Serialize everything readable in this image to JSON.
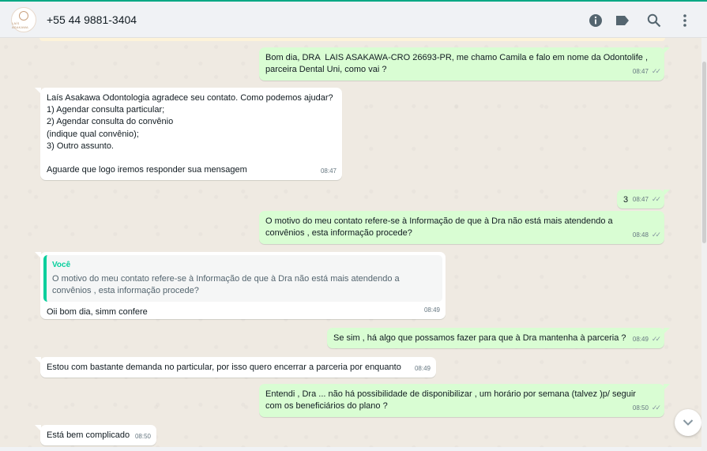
{
  "header": {
    "avatar_text": "LAÍS ASAKAWA",
    "contact_name": "+55 44 9881-3404",
    "icons": [
      "info-icon",
      "label-icon",
      "search-icon",
      "menu-icon"
    ]
  },
  "messages": [
    {
      "dir": "out",
      "text": "Bom dia, DRA  LAIS ASAKAWA-CRO 26693-PR, me chamo Camila e falo em nome da Odontolife ,\nparceira Dental Uni, como vai ?",
      "time": "08:47",
      "ticks": "✓✓"
    },
    {
      "dir": "in",
      "text": "Laís Asakawa Odontologia agradece seu contato. Como podemos ajudar?\n1) Agendar consulta particular;\n2) Agendar consulta do convênio\n(indique qual convênio);\n3) Outro assunto.\n\nAguarde que logo iremos responder sua mensagem",
      "time": "08:47"
    },
    {
      "dir": "out",
      "text": "3",
      "time": "08:47",
      "ticks": "✓✓"
    },
    {
      "dir": "out",
      "text": "O motivo do meu contato refere-se à Informação de que à Dra não está mais atendendo a\nconvênios , esta informação procede?",
      "time": "08:48",
      "ticks": "✓✓"
    },
    {
      "dir": "in",
      "quote_author": "Você",
      "quote_text": "O motivo do meu contato refere-se à Informação de que à Dra não está mais atendendo a convênios ,\nesta informação procede?",
      "text": "Oii bom dia, simm confere",
      "time": "08:49"
    },
    {
      "dir": "out",
      "text": "Se sim , há algo que possamos fazer para que à Dra mantenha à parceria ?",
      "time": "08:49",
      "ticks": "✓✓"
    },
    {
      "dir": "in",
      "text": "Estou com bastante demanda no particular, por isso quero encerrar a parceria por enquanto",
      "time": "08:49"
    },
    {
      "dir": "out",
      "text": "Entendi , Dra ... não há possibilidade de disponibilizar , um horário por semana (talvez )p/ seguir\ncom os beneficiários do plano ?",
      "time": "08:50",
      "ticks": "✓✓"
    },
    {
      "dir": "in",
      "text": "Está bem complicado",
      "time": "08:50"
    }
  ],
  "colors": {
    "outgoing_bubble": "#d9fdd3",
    "incoming_bubble": "#ffffff",
    "accent": "#00a884",
    "chat_background": "#efeae2"
  }
}
